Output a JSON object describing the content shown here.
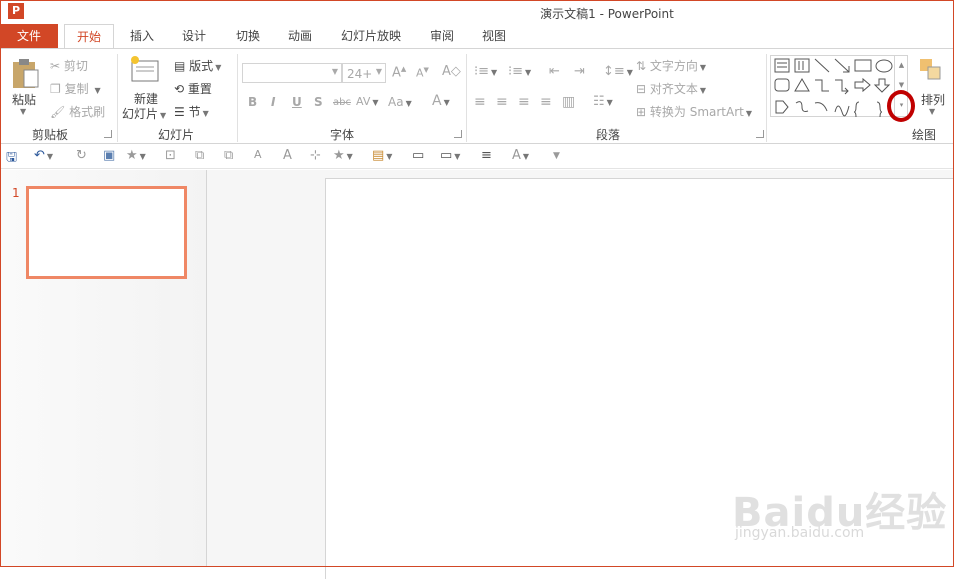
{
  "window": {
    "title": "演示文稿1 - PowerPoint",
    "app_icon": "P"
  },
  "tabs": [
    "文件",
    "开始",
    "插入",
    "设计",
    "切换",
    "动画",
    "幻灯片放映",
    "审阅",
    "视图"
  ],
  "ribbon": {
    "clipboard": {
      "label": "剪贴板",
      "paste": "粘贴",
      "cut": "剪切",
      "copy": "复制",
      "format_painter": "格式刷"
    },
    "slides": {
      "label": "幻灯片",
      "new_slide_1": "新建",
      "new_slide_2": "幻灯片",
      "layout": "版式",
      "reset": "重置",
      "section": "节"
    },
    "font": {
      "label": "字体",
      "font_name": "",
      "font_size": "24+",
      "bold": "B",
      "italic": "I",
      "underline": "U",
      "shadow": "S",
      "strike": "abc",
      "spacing": "AV",
      "case": "Aa",
      "color": "A"
    },
    "paragraph": {
      "label": "段落",
      "text_direction": "文字方向",
      "align_text": "对齐文本",
      "smartart": "转换为 SmartArt"
    },
    "drawing": {
      "label": "绘图",
      "arrange": "排列"
    }
  },
  "slide_panel": {
    "slide_number": "1"
  },
  "watermark": {
    "brand": "Baidu经验",
    "url": "jingyan.baidu.com"
  },
  "colors": {
    "accent": "#d24726",
    "highlight_circle": "#c00000",
    "thumb_border": "#ef8765"
  }
}
